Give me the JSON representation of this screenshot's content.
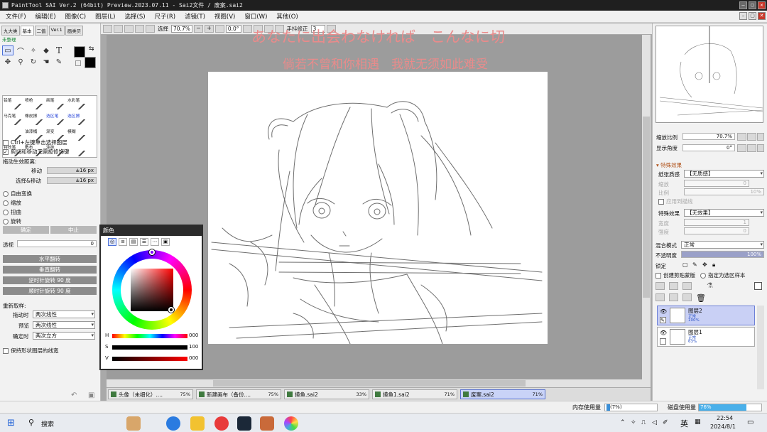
{
  "title": "PaintTool SAI Ver.2 (64bit) Preview.2023.07.11 - Sai2文件 / 废案.sai2",
  "menu": [
    "文件(F)",
    "编辑(E)",
    "图像(C)",
    "图层(L)",
    "选择(S)",
    "尺子(R)",
    "滤镜(T)",
    "视图(V)",
    "窗口(W)",
    "其他(O)"
  ],
  "toolbar": {
    "select_label": "选择",
    "zoom": "70.7%",
    "angle": "0.0°",
    "stabilizer_label": "手抖修正",
    "stabilizer": "3"
  },
  "left": {
    "tabs": [
      "九大类",
      "基本",
      "二值",
      "Ver.1",
      "画类贝"
    ],
    "subtab": "未整理",
    "brushes": [
      {
        "n": "铅笔",
        "blue": false
      },
      {
        "n": "喷枪",
        "blue": false
      },
      {
        "n": "画笔",
        "blue": false
      },
      {
        "n": "水彩笔",
        "blue": false
      },
      {
        "n": "马克笔",
        "blue": false
      },
      {
        "n": "橡皮擦",
        "blue": false
      },
      {
        "n": "选区笔",
        "blue": true
      },
      {
        "n": "选区擦",
        "blue": true
      },
      {
        "n": "",
        "blue": false
      },
      {
        "n": "油漆桶",
        "blue": false
      },
      {
        "n": "渐变",
        "blue": false
      },
      {
        "n": "模糊",
        "blue": false
      },
      {
        "n": "特效笔",
        "blue": false
      },
      {
        "n": "散布",
        "blue": false
      },
      {
        "n": "涂抹",
        "blue": false
      },
      {
        "n": "",
        "blue": false
      }
    ],
    "ctrl_click": "Ctrl+左键单击选择图层",
    "cut_move": "剪切和移动无需按修饰键",
    "drag_label": "拖动生效距离:",
    "move_label": "移动",
    "move_val": "±16 px",
    "selmove_label": "选择&移动",
    "selmove_val": "±16 px",
    "transforms": [
      "自由变换",
      "缩放",
      "扭曲",
      "旋转"
    ],
    "ok": "确定",
    "cancel": "中止",
    "perspective_label": "透视",
    "perspective_val": "0",
    "buttons": [
      "水平翻转",
      "垂直翻转",
      "逆时针旋转 90 度",
      "顺时针旋转 90 度"
    ],
    "resample": "重新取样:",
    "drag_mode_label": "拖动时",
    "drag_mode": "两次线性",
    "preview_label": "预览",
    "preview_mode": "两次线性",
    "confirm_label": "确定时",
    "confirm_mode": "两次立方",
    "keep_line": "保持形状图层的线宽"
  },
  "overlay": {
    "jp": "あなたに出会わなければ　こんなに切",
    "cn": "倘若不曾和你相遇　我就无须如此难受"
  },
  "color_window": {
    "title": "颜色",
    "h_label": "H",
    "h_val": "000",
    "s_label": "S",
    "s_val": "100",
    "v_label": "V",
    "v_val": "000"
  },
  "doc_tabs": [
    {
      "name": "头像（未细化）....",
      "pct": "75%"
    },
    {
      "name": "新建画布（备份....",
      "pct": "75%"
    },
    {
      "name": "摸鱼.sai2",
      "pct": "33%"
    },
    {
      "name": "摸鱼1.sai2",
      "pct": "71%"
    },
    {
      "name": "废案.sai2",
      "pct": "71%",
      "active": true
    }
  ],
  "right": {
    "zoom_label": "缩放比例",
    "zoom_val": "70.7%",
    "angle_label": "显示角度",
    "angle_val": "0°",
    "effects_header": "特殊效果",
    "paper_label": "纸张质感",
    "paper_val": "【无质感】",
    "scale_label": "缩放",
    "scale_val": "0",
    "ratio_label": "比例",
    "ratio_val": "10%",
    "apply_outline": "应用到描线",
    "effect_label": "特殊效果",
    "effect_val": "【无效果】",
    "width_label": "宽度",
    "width_val": "1",
    "strength_label": "强度",
    "strength_val": "0",
    "blend_label": "混合模式",
    "blend_val": "正常",
    "opacity_label": "不透明度",
    "opacity_val": "100%",
    "lock_label": "锁定",
    "clip_label": "创建剪贴蒙版",
    "sample_label": "指定为选区样本",
    "layers": [
      {
        "name": "图层2",
        "mode": "正常",
        "opacity": "100%"
      },
      {
        "name": "图层1",
        "mode": "正常",
        "opacity": "63%"
      }
    ]
  },
  "status": {
    "mem_label": "内存使用量",
    "mem_val": "(7%)",
    "disk_label": "磁盘使用量",
    "disk_val": "76%"
  },
  "taskbar": {
    "search": "搜索",
    "lang": "英",
    "time": "22:54",
    "date": "2024/8/1"
  }
}
